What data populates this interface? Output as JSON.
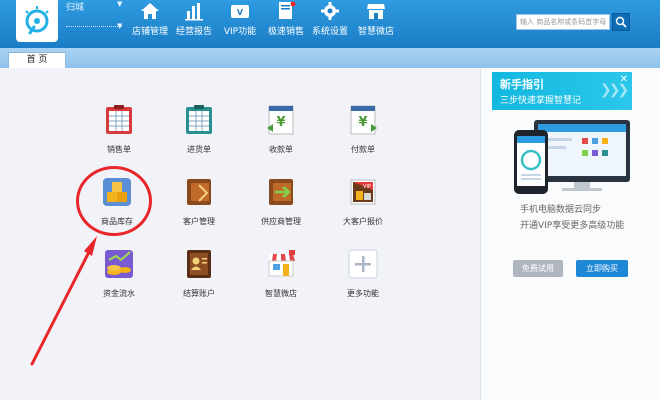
{
  "topbar": {
    "user_name": "归城",
    "nav": [
      {
        "label": "店铺管理",
        "icon": "home-icon"
      },
      {
        "label": "经营报告",
        "icon": "bar-chart-icon"
      },
      {
        "label": "VIP功能",
        "icon": "vip-card-icon"
      },
      {
        "label": "极速销售",
        "icon": "fast-sales-icon"
      },
      {
        "label": "系统设置",
        "icon": "gear-icon"
      },
      {
        "label": "智慧微店",
        "icon": "shop-icon"
      }
    ],
    "search": {
      "placeholder": "输入 商品名称或条码首字母"
    }
  },
  "tabs": [
    {
      "label": "首 页"
    }
  ],
  "apps": [
    {
      "label": "销售单",
      "icon": "sales-order-icon"
    },
    {
      "label": "进货单",
      "icon": "purchase-order-icon"
    },
    {
      "label": "收款单",
      "icon": "receipt-icon"
    },
    {
      "label": "付款单",
      "icon": "payment-icon"
    },
    {
      "label": "商品库存",
      "icon": "inventory-icon"
    },
    {
      "label": "客户管理",
      "icon": "customer-icon"
    },
    {
      "label": "供应商管理",
      "icon": "supplier-icon"
    },
    {
      "label": "大客户报价",
      "icon": "quote-icon"
    },
    {
      "label": "资金流水",
      "icon": "cash-flow-icon"
    },
    {
      "label": "结算账户",
      "icon": "account-icon"
    },
    {
      "label": "智慧微店",
      "icon": "micro-store-icon"
    },
    {
      "label": "更多功能",
      "icon": "plus-icon"
    }
  ],
  "guide": {
    "title": "新手指引",
    "subtitle": "三步快速掌握智慧记",
    "line1": "手机电脑数据云同步",
    "line2": "开通VIP享受更多高级功能",
    "trial_button": "免费试用",
    "buy_button": "立即购买"
  },
  "colors": {
    "topbar": "#1b7dc6",
    "accent": "#1f87d8",
    "highlight": "#e8262b"
  }
}
